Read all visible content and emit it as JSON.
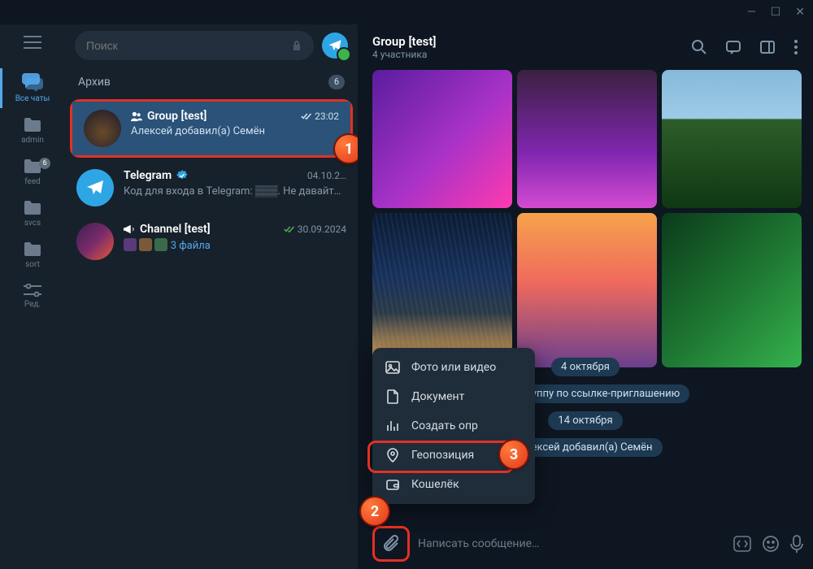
{
  "window": {
    "minimize": "—",
    "maximize": "☐",
    "close": "✕"
  },
  "search": {
    "placeholder": "Поиск"
  },
  "logo_icon": "telegram",
  "rail": [
    {
      "id": "all",
      "label": "Все чаты",
      "icon": "chats-icon",
      "active": true
    },
    {
      "id": "admin",
      "label": "admin",
      "icon": "folder-icon"
    },
    {
      "id": "feed",
      "label": "feed",
      "icon": "folder-icon",
      "badge": "6"
    },
    {
      "id": "svcs",
      "label": "svcs",
      "icon": "folder-icon"
    },
    {
      "id": "sort",
      "label": "sort",
      "icon": "folder-icon"
    },
    {
      "id": "edit",
      "label": "Ред.",
      "icon": "sliders-icon"
    }
  ],
  "archive": {
    "label": "Архив",
    "count": "6"
  },
  "chats": [
    {
      "name": "Group [test]",
      "kind": "group",
      "preview": "Алексей добавил(а) Семён",
      "time": "23:02",
      "checks": true,
      "selected": true
    },
    {
      "name": "Telegram",
      "kind": "verified",
      "preview": "Код для входа в Telegram: ▒▒▒. Не давайт…",
      "time": "04.10.2…"
    },
    {
      "name": "Channel [test]",
      "kind": "channel",
      "preview": "3 файла",
      "time": "30.09.2024",
      "checks": true,
      "thumbs": true
    }
  ],
  "conv": {
    "title": "Group [test]",
    "subtitle": "4 участника",
    "date1": "4 октября",
    "sys1": "л(а) в группу по ссылке-приглашению",
    "date2": "14 октября",
    "sys2": "Алексей добавил(а) Семён",
    "input_placeholder": "Написать сообщение…"
  },
  "attach_menu": [
    {
      "icon": "image-icon",
      "label": "Фото или видео"
    },
    {
      "icon": "document-icon",
      "label": "Документ"
    },
    {
      "icon": "poll-icon",
      "label": "Создать опр"
    },
    {
      "icon": "location-icon",
      "label": "Геопозиция"
    },
    {
      "icon": "wallet-icon",
      "label": "Кошелёк"
    }
  ],
  "steps": {
    "s1": "1",
    "s2": "2",
    "s3": "3"
  }
}
